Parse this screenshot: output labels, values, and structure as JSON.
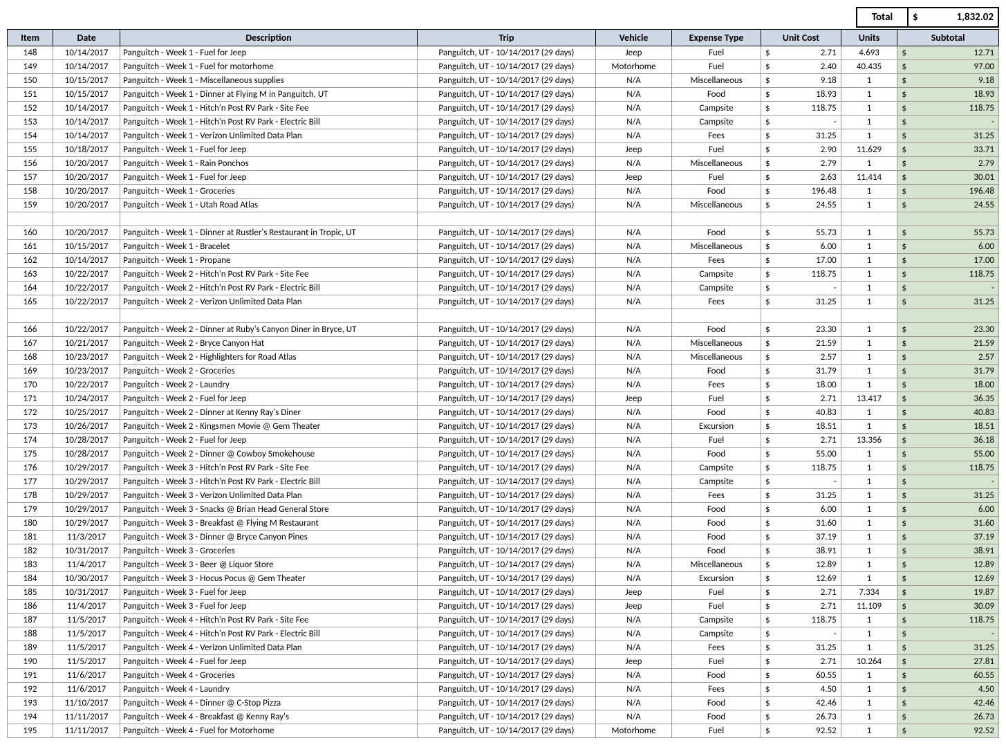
{
  "total": {
    "label": "Total",
    "currency": "$",
    "amount": "1,832.02"
  },
  "headers": [
    "Item",
    "Date",
    "Description",
    "Trip",
    "Vehicle",
    "Expense Type",
    "Unit Cost",
    "Units",
    "Subtotal"
  ],
  "trip_text": "Panguitch, UT - 10/14/2017 (29 days)",
  "rows": [
    {
      "item": "148",
      "date": "10/14/2017",
      "desc": "Panguitch - Week 1 - Fuel for Jeep",
      "vehicle": "Jeep",
      "etype": "Fuel",
      "uc": "2.71",
      "units": "4.693",
      "sub": "12.71"
    },
    {
      "item": "149",
      "date": "10/14/2017",
      "desc": "Panguitch - Week 1 - Fuel for motorhome",
      "vehicle": "Motorhome",
      "etype": "Fuel",
      "uc": "2.40",
      "units": "40.435",
      "sub": "97.00"
    },
    {
      "item": "150",
      "date": "10/15/2017",
      "desc": "Panguitch - Week 1 - Miscellaneous supplies",
      "vehicle": "N/A",
      "etype": "Miscellaneous",
      "uc": "9.18",
      "units": "1",
      "sub": "9.18"
    },
    {
      "item": "151",
      "date": "10/15/2017",
      "desc": "Panguitch - Week 1 - Dinner at Flying M in Panguitch, UT",
      "vehicle": "N/A",
      "etype": "Food",
      "uc": "18.93",
      "units": "1",
      "sub": "18.93"
    },
    {
      "item": "152",
      "date": "10/14/2017",
      "desc": "Panguitch - Week 1 - Hitch'n Post RV Park - Site Fee",
      "vehicle": "N/A",
      "etype": "Campsite",
      "uc": "118.75",
      "units": "1",
      "sub": "118.75"
    },
    {
      "item": "153",
      "date": "10/14/2017",
      "desc": "Panguitch - Week 1 - Hitch'n Post RV Park - Electric Bill",
      "vehicle": "N/A",
      "etype": "Campsite",
      "uc": "-",
      "units": "1",
      "sub": "-"
    },
    {
      "item": "154",
      "date": "10/14/2017",
      "desc": "Panguitch - Week 1 - Verizon Unlimited Data Plan",
      "vehicle": "N/A",
      "etype": "Fees",
      "uc": "31.25",
      "units": "1",
      "sub": "31.25"
    },
    {
      "item": "155",
      "date": "10/18/2017",
      "desc": "Panguitch - Week 1 - Fuel for Jeep",
      "vehicle": "Jeep",
      "etype": "Fuel",
      "uc": "2.90",
      "units": "11.629",
      "sub": "33.71"
    },
    {
      "item": "156",
      "date": "10/20/2017",
      "desc": "Panguitch - Week 1 - Rain Ponchos",
      "vehicle": "N/A",
      "etype": "Miscellaneous",
      "uc": "2.79",
      "units": "1",
      "sub": "2.79"
    },
    {
      "item": "157",
      "date": "10/20/2017",
      "desc": "Panguitch - Week 1 - Fuel for Jeep",
      "vehicle": "Jeep",
      "etype": "Fuel",
      "uc": "2.63",
      "units": "11.414",
      "sub": "30.01"
    },
    {
      "item": "158",
      "date": "10/20/2017",
      "desc": "Panguitch - Week 1 - Groceries",
      "vehicle": "N/A",
      "etype": "Food",
      "uc": "196.48",
      "units": "1",
      "sub": "196.48"
    },
    {
      "item": "159",
      "date": "10/20/2017",
      "desc": "Panguitch - Week 1 - Utah Road Atlas",
      "vehicle": "N/A",
      "etype": "Miscellaneous",
      "uc": "24.55",
      "units": "1",
      "sub": "24.55"
    },
    {
      "spacer": true
    },
    {
      "item": "160",
      "date": "10/20/2017",
      "desc": "Panguitch - Week 1 - Dinner at Rustler's Restaurant in Tropic, UT",
      "vehicle": "N/A",
      "etype": "Food",
      "uc": "55.73",
      "units": "1",
      "sub": "55.73"
    },
    {
      "item": "161",
      "date": "10/15/2017",
      "desc": "Panguitch - Week 1 - Bracelet",
      "vehicle": "N/A",
      "etype": "Miscellaneous",
      "uc": "6.00",
      "units": "1",
      "sub": "6.00"
    },
    {
      "item": "162",
      "date": "10/14/2017",
      "desc": "Panguitch - Week 1 - Propane",
      "vehicle": "N/A",
      "etype": "Fees",
      "uc": "17.00",
      "units": "1",
      "sub": "17.00"
    },
    {
      "item": "163",
      "date": "10/22/2017",
      "desc": "Panguitch - Week 2 - Hitch'n Post RV Park - Site Fee",
      "vehicle": "N/A",
      "etype": "Campsite",
      "uc": "118.75",
      "units": "1",
      "sub": "118.75"
    },
    {
      "item": "164",
      "date": "10/22/2017",
      "desc": "Panguitch - Week 2 - Hitch'n Post RV Park - Electric Bill",
      "vehicle": "N/A",
      "etype": "Campsite",
      "uc": "-",
      "units": "1",
      "sub": "-"
    },
    {
      "item": "165",
      "date": "10/22/2017",
      "desc": "Panguitch - Week 2 - Verizon Unlimited Data Plan",
      "vehicle": "N/A",
      "etype": "Fees",
      "uc": "31.25",
      "units": "1",
      "sub": "31.25"
    },
    {
      "spacer": true
    },
    {
      "item": "166",
      "date": "10/22/2017",
      "desc": "Panguitch - Week 2 - Dinner at Ruby's Canyon Diner in Bryce, UT",
      "vehicle": "N/A",
      "etype": "Food",
      "uc": "23.30",
      "units": "1",
      "sub": "23.30"
    },
    {
      "item": "167",
      "date": "10/21/2017",
      "desc": "Panguitch - Week 2  - Bryce Canyon Hat",
      "vehicle": "N/A",
      "etype": "Miscellaneous",
      "uc": "21.59",
      "units": "1",
      "sub": "21.59"
    },
    {
      "item": "168",
      "date": "10/23/2017",
      "desc": "Panguitch - Week 2 - Highlighters for Road Atlas",
      "vehicle": "N/A",
      "etype": "Miscellaneous",
      "uc": "2.57",
      "units": "1",
      "sub": "2.57"
    },
    {
      "item": "169",
      "date": "10/23/2017",
      "desc": "Panguitch - Week 2 - Groceries",
      "vehicle": "N/A",
      "etype": "Food",
      "uc": "31.79",
      "units": "1",
      "sub": "31.79"
    },
    {
      "item": "170",
      "date": "10/22/2017",
      "desc": "Panguitch - Week 2 - Laundry",
      "vehicle": "N/A",
      "etype": "Fees",
      "uc": "18.00",
      "units": "1",
      "sub": "18.00"
    },
    {
      "item": "171",
      "date": "10/24/2017",
      "desc": "Panguitch - Week 2 - Fuel for Jeep",
      "vehicle": "Jeep",
      "etype": "Fuel",
      "uc": "2.71",
      "units": "13.417",
      "sub": "36.35"
    },
    {
      "item": "172",
      "date": "10/25/2017",
      "desc": "Panguitch - Week 2 - Dinner at Kenny Ray's Diner",
      "vehicle": "N/A",
      "etype": "Food",
      "uc": "40.83",
      "units": "1",
      "sub": "40.83"
    },
    {
      "item": "173",
      "date": "10/26/2017",
      "desc": "Panguitch - Week 2 - Kingsmen Movie @ Gem Theater",
      "vehicle": "N/A",
      "etype": "Excursion",
      "uc": "18.51",
      "units": "1",
      "sub": "18.51"
    },
    {
      "item": "174",
      "date": "10/28/2017",
      "desc": "Panguitch - Week 2 - Fuel for Jeep",
      "vehicle": "N/A",
      "etype": "Fuel",
      "uc": "2.71",
      "units": "13.356",
      "sub": "36.18"
    },
    {
      "item": "175",
      "date": "10/28/2017",
      "desc": "Panguitch - Week 2 - Dinner @ Cowboy Smokehouse",
      "vehicle": "N/A",
      "etype": "Food",
      "uc": "55.00",
      "units": "1",
      "sub": "55.00"
    },
    {
      "item": "176",
      "date": "10/29/2017",
      "desc": "Panguitch - Week 3 - Hitch'n Post RV Park - Site Fee",
      "vehicle": "N/A",
      "etype": "Campsite",
      "uc": "118.75",
      "units": "1",
      "sub": "118.75"
    },
    {
      "item": "177",
      "date": "10/29/2017",
      "desc": "Panguitch - Week 3 - Hitch'n Post RV Park - Electric Bill",
      "vehicle": "N/A",
      "etype": "Campsite",
      "uc": "-",
      "units": "1",
      "sub": "-"
    },
    {
      "item": "178",
      "date": "10/29/2017",
      "desc": "Panguitch - Week 3 - Verizon Unlimited Data Plan",
      "vehicle": "N/A",
      "etype": "Fees",
      "uc": "31.25",
      "units": "1",
      "sub": "31.25"
    },
    {
      "item": "179",
      "date": "10/29/2017",
      "desc": "Panguitch - Week 3 - Snacks @ Brian Head General Store",
      "vehicle": "N/A",
      "etype": "Food",
      "uc": "6.00",
      "units": "1",
      "sub": "6.00"
    },
    {
      "item": "180",
      "date": "10/29/2017",
      "desc": "Panguitch - Week 3 - Breakfast @ Flying M Restaurant",
      "vehicle": "N/A",
      "etype": "Food",
      "uc": "31.60",
      "units": "1",
      "sub": "31.60"
    },
    {
      "item": "181",
      "date": "11/3/2017",
      "desc": "Panguitch - Week 3 - Dinner @ Bryce Canyon Pines",
      "vehicle": "N/A",
      "etype": "Food",
      "uc": "37.19",
      "units": "1",
      "sub": "37.19"
    },
    {
      "item": "182",
      "date": "10/31/2017",
      "desc": "Panguitch - Week 3 - Groceries",
      "vehicle": "N/A",
      "etype": "Food",
      "uc": "38.91",
      "units": "1",
      "sub": "38.91"
    },
    {
      "item": "183",
      "date": "11/4/2017",
      "desc": "Panguitch - Week 3 - Beer @ Liquor Store",
      "vehicle": "N/A",
      "etype": "Miscellaneous",
      "uc": "12.89",
      "units": "1",
      "sub": "12.89"
    },
    {
      "item": "184",
      "date": "10/30/2017",
      "desc": "Panguitch - Week 3 - Hocus Pocus @ Gem Theater",
      "vehicle": "N/A",
      "etype": "Excursion",
      "uc": "12.69",
      "units": "1",
      "sub": "12.69"
    },
    {
      "item": "185",
      "date": "10/31/2017",
      "desc": "Panguitch - Week 3 - Fuel for Jeep",
      "vehicle": "Jeep",
      "etype": "Fuel",
      "uc": "2.71",
      "units": "7.334",
      "sub": "19.87"
    },
    {
      "item": "186",
      "date": "11/4/2017",
      "desc": "Panguitch - Week 3 - Fuel for Jeep",
      "vehicle": "Jeep",
      "etype": "Fuel",
      "uc": "2.71",
      "units": "11.109",
      "sub": "30.09"
    },
    {
      "item": "187",
      "date": "11/5/2017",
      "desc": "Panguitch - Week 4 - Hitch'n Post RV Park - Site Fee",
      "vehicle": "N/A",
      "etype": "Campsite",
      "uc": "118.75",
      "units": "1",
      "sub": "118.75"
    },
    {
      "item": "188",
      "date": "11/5/2017",
      "desc": "Panguitch - Week 4 - Hitch'n Post RV Park - Electric Bill",
      "vehicle": "N/A",
      "etype": "Campsite",
      "uc": "-",
      "units": "1",
      "sub": "-"
    },
    {
      "item": "189",
      "date": "11/5/2017",
      "desc": "Panguitch - Week 4 - Verizon Unlimited Data Plan",
      "vehicle": "N/A",
      "etype": "Fees",
      "uc": "31.25",
      "units": "1",
      "sub": "31.25"
    },
    {
      "item": "190",
      "date": "11/5/2017",
      "desc": "Panguitch - Week 4 - Fuel for Jeep",
      "vehicle": "Jeep",
      "etype": "Fuel",
      "uc": "2.71",
      "units": "10.264",
      "sub": "27.81"
    },
    {
      "item": "191",
      "date": "11/6/2017",
      "desc": "Panguitch - Week 4 - Groceries",
      "vehicle": "N/A",
      "etype": "Food",
      "uc": "60.55",
      "units": "1",
      "sub": "60.55"
    },
    {
      "item": "192",
      "date": "11/6/2017",
      "desc": "Panguitch - Week 4 - Laundry",
      "vehicle": "N/A",
      "etype": "Fees",
      "uc": "4.50",
      "units": "1",
      "sub": "4.50"
    },
    {
      "item": "193",
      "date": "11/10/2017",
      "desc": "Panguitch - Week 4 - Dinner @ C-Stop Pizza",
      "vehicle": "N/A",
      "etype": "Food",
      "uc": "42.46",
      "units": "1",
      "sub": "42.46"
    },
    {
      "item": "194",
      "date": "11/11/2017",
      "desc": "Panguitch - Week 4 - Breakfast @ Kenny Ray's",
      "vehicle": "N/A",
      "etype": "Food",
      "uc": "26.73",
      "units": "1",
      "sub": "26.73"
    },
    {
      "item": "195",
      "date": "11/11/2017",
      "desc": "Panguitch - Week 4 - Fuel for Motorhome",
      "vehicle": "Motorhome",
      "etype": "Fuel",
      "uc": "92.52",
      "units": "1",
      "sub": "92.52"
    }
  ]
}
